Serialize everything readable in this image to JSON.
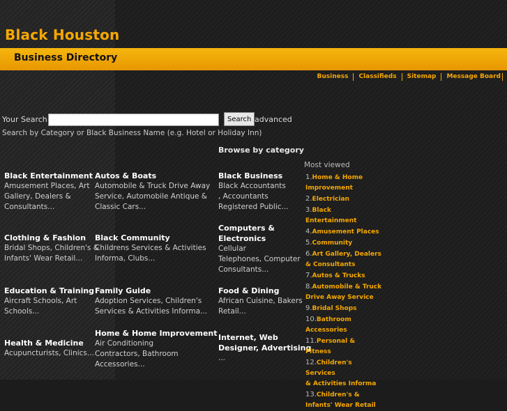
{
  "header": {
    "brand": "Black Houston",
    "subtitle": "Business Directory",
    "nav": [
      "Business",
      "Classifieds",
      "Sitemap",
      "Message Board"
    ]
  },
  "search": {
    "label": "Your Search:",
    "value": "",
    "button": "Search",
    "advanced": "advanced",
    "hint": "Search by Category or Black Business Name (e.g. Hotel or Holiday Inn)"
  },
  "browse_title": "Browse by category",
  "categories": [
    {
      "title": "Black Entertainment",
      "sub": [
        "Amusement Places, Art",
        "Gallery, Dealers &",
        "Consultants..."
      ]
    },
    {
      "title": "Autos & Boats",
      "sub": [
        "Automobile & Truck Drive Away",
        "Service, Automobile Antique &",
        "Classic Cars..."
      ]
    },
    {
      "title": "Black Business",
      "sub": [
        "Black Accountants",
        ", Accountants",
        "Registered Public..."
      ]
    },
    {
      "title": "Clothing & Fashion",
      "sub": [
        "Bridal Shops, Children's &",
        "Infants' Wear Retail..."
      ]
    },
    {
      "title": "Black Community",
      "sub": [
        "Childrens Services & Activities",
        "Informa, Clubs..."
      ]
    },
    {
      "title_lines": [
        "Computers &",
        "Electronics"
      ],
      "sub": [
        "Cellular",
        "Telephones, Computer",
        "Consultants..."
      ]
    },
    {
      "title": "Education & Training",
      "sub": [
        "Aircraft Schools, Art",
        "Schools..."
      ]
    },
    {
      "title": "Family Guide",
      "sub": [
        "Adoption Services, Children's",
        "Services & Activities Informa..."
      ]
    },
    {
      "title": "Food & Dining",
      "sub": [
        "African Cuisine, Bakers",
        "Retail..."
      ]
    },
    {
      "title": "Health & Medicine",
      "sub": [
        "Acupuncturists, Clinics..."
      ]
    },
    {
      "title": "Home & Home Improvement",
      "sub": [
        "Air Conditioning",
        "Contractors, Bathroom",
        "Accessories..."
      ]
    },
    {
      "title_lines": [
        "Internet, Web",
        "Designer, Advertising"
      ],
      "sub": [
        "..."
      ]
    }
  ],
  "most_viewed": {
    "title": "Most viewed",
    "items": [
      {
        "n": "1.",
        "lines": [
          "Home & Home",
          "Improvement"
        ]
      },
      {
        "n": "2.",
        "lines": [
          "Electrician"
        ]
      },
      {
        "n": "3.",
        "lines": [
          "Black Entertainment"
        ]
      },
      {
        "n": "4.",
        "lines": [
          "Amusement Places"
        ]
      },
      {
        "n": "5.",
        "lines": [
          "Community"
        ]
      },
      {
        "n": "6.",
        "lines": [
          "Art Gallery, Dealers",
          "& Consultants"
        ]
      },
      {
        "n": "7.",
        "lines": [
          "Autos & Trucks"
        ]
      },
      {
        "n": "8.",
        "lines": [
          "Automobile & Truck",
          "Drive Away Service"
        ]
      },
      {
        "n": "9.",
        "lines": [
          "Bridal Shops"
        ]
      },
      {
        "n": "10.",
        "lines": [
          "Bathroom",
          "Accessories"
        ]
      },
      {
        "n": "11.",
        "lines": [
          "Personal & Fitness"
        ]
      },
      {
        "n": "12.",
        "lines": [
          "Children's Services",
          "& Activities Informa"
        ]
      },
      {
        "n": "13.",
        "lines": [
          "Children's &",
          "Infants' Wear Retail"
        ]
      }
    ]
  }
}
